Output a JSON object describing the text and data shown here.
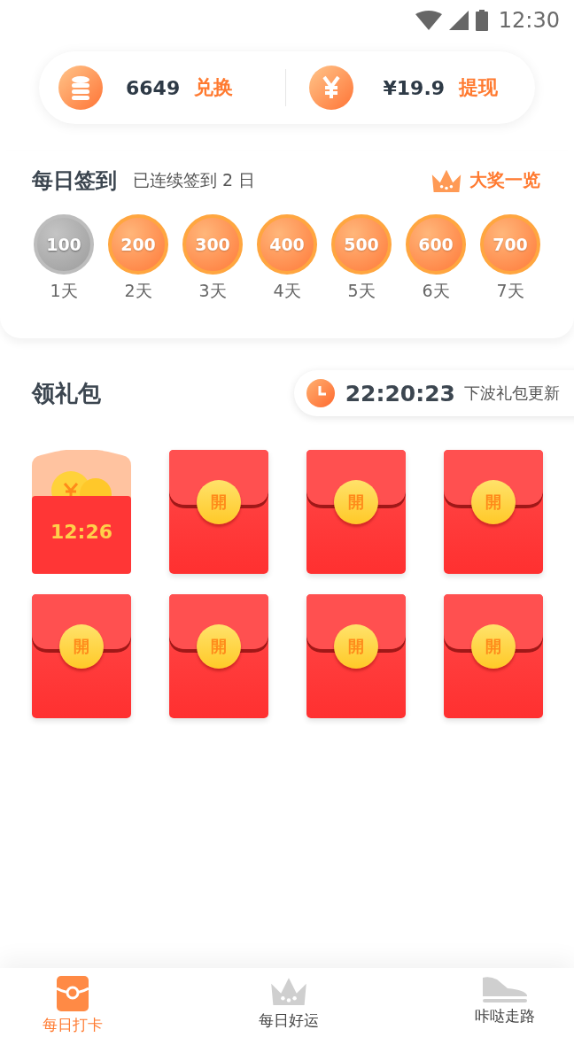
{
  "status_bar": {
    "time": "12:30"
  },
  "balance": {
    "coins": "6649",
    "coins_action": "兑换",
    "cash": "¥19.9",
    "cash_action": "提现"
  },
  "checkin": {
    "title": "每日签到",
    "streak": "已连续签到 2 日",
    "prize_link": "大奖一览",
    "days": [
      {
        "amount": "100",
        "label": "1天",
        "claimed": true
      },
      {
        "amount": "200",
        "label": "2天",
        "claimed": false
      },
      {
        "amount": "300",
        "label": "3天",
        "claimed": false
      },
      {
        "amount": "400",
        "label": "4天",
        "claimed": false
      },
      {
        "amount": "500",
        "label": "5天",
        "claimed": false
      },
      {
        "amount": "600",
        "label": "6天",
        "claimed": false
      },
      {
        "amount": "700",
        "label": "7天",
        "claimed": false
      }
    ]
  },
  "gifts": {
    "title": "领礼包",
    "countdown": "22:20:23",
    "countdown_label": "下波礼包更新",
    "envelopes": [
      {
        "kind": "opened",
        "timer": "12:26"
      },
      {
        "kind": "closed",
        "button": "開"
      },
      {
        "kind": "closed",
        "button": "開"
      },
      {
        "kind": "closed",
        "button": "開"
      },
      {
        "kind": "closed",
        "button": "開"
      },
      {
        "kind": "closed",
        "button": "開"
      },
      {
        "kind": "closed",
        "button": "開"
      },
      {
        "kind": "closed",
        "button": "開"
      }
    ]
  },
  "tabs": [
    {
      "label": "每日打卡",
      "selected": true
    },
    {
      "label": "每日好运",
      "selected": false
    },
    {
      "label": "咔哒走路",
      "selected": false
    }
  ]
}
